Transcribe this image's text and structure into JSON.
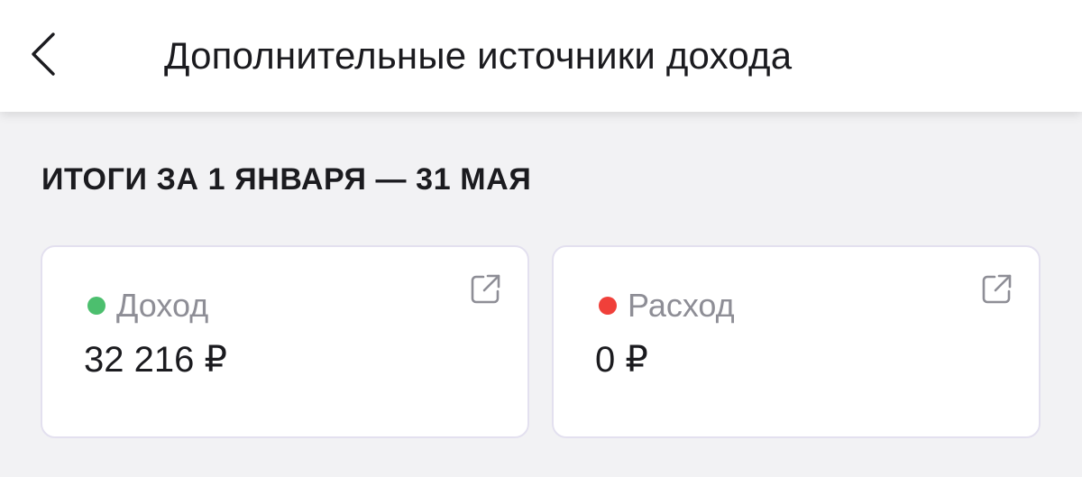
{
  "header": {
    "title": "Дополнительные источники дохода",
    "back_icon": "chevron-left-icon"
  },
  "summary": {
    "period_title": "ИТОГИ ЗА 1 ЯНВАРЯ — 31 МАЯ"
  },
  "cards": [
    {
      "label": "Доход",
      "value": "32 216 ₽",
      "dot_color": "#4cbf6e",
      "icon": "external-link-icon"
    },
    {
      "label": "Расход",
      "value": "0 ₽",
      "dot_color": "#f0403a",
      "icon": "external-link-icon"
    }
  ]
}
